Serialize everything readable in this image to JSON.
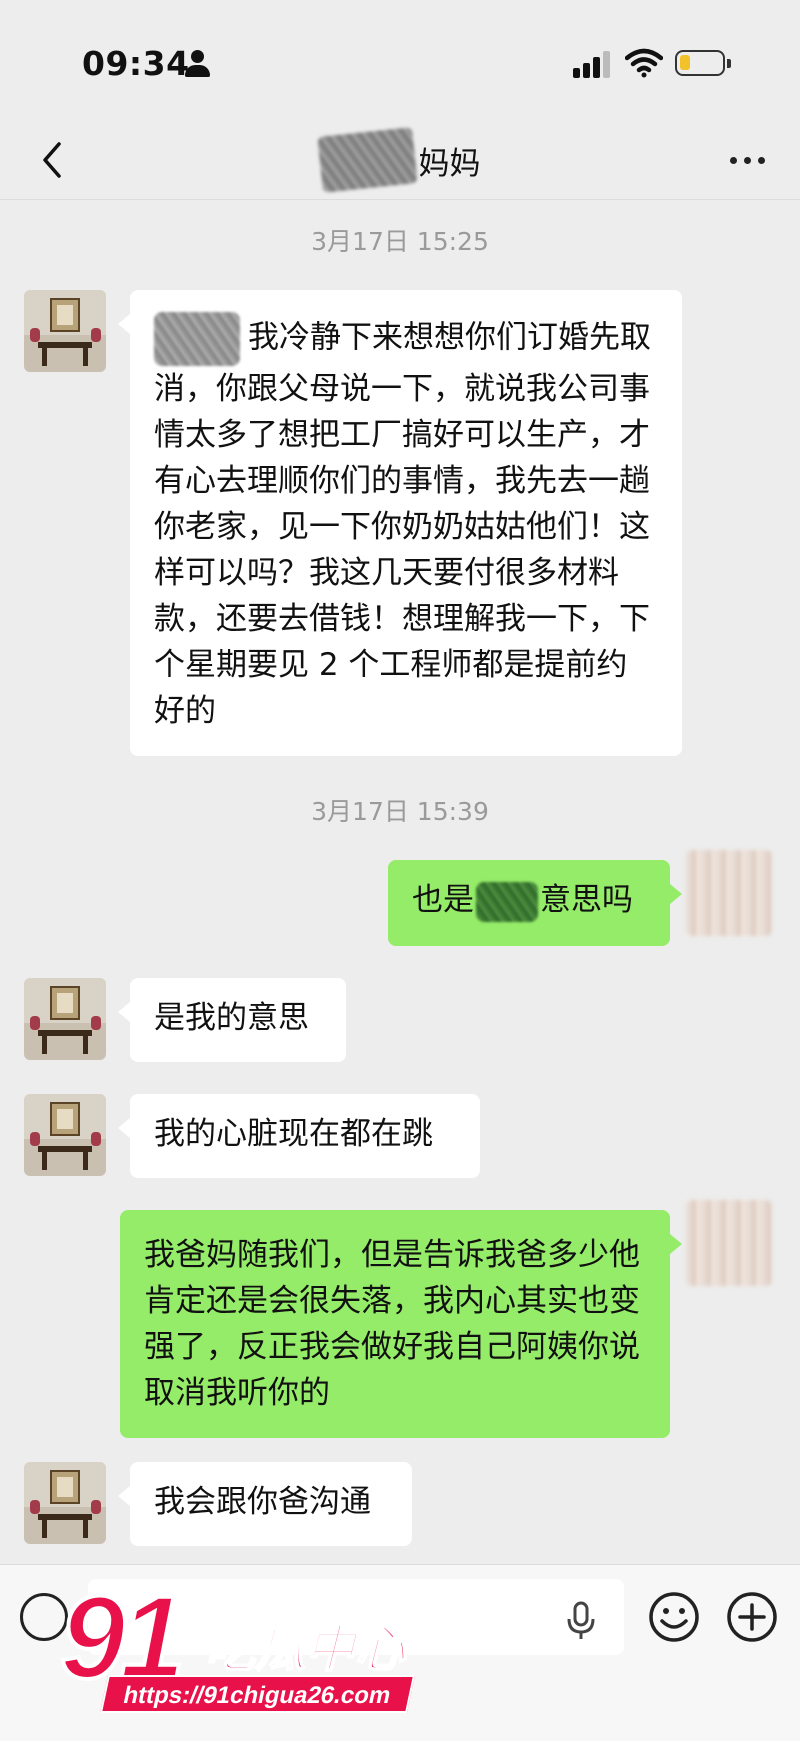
{
  "status_bar": {
    "time": "09:34"
  },
  "header": {
    "title": "妈妈"
  },
  "messages": [
    {
      "type": "time",
      "text": "3月17日 15:25"
    },
    {
      "type": "in",
      "text": "我冷静下来想想你们订婚先取消，你跟父母说一下，就说我公司事情太多了想把工厂搞好可以生产，才有心去理顺你们的事情，我先去一趟你老家，见一下你奶奶姑姑他们！这样可以吗？我这几天要付很多材料款，还要去借钱！想理解我一下，下个星期要见 2 个工程师都是提前约好的"
    },
    {
      "type": "time",
      "text": "3月17日 15:39"
    },
    {
      "type": "out",
      "text_before": "也是",
      "text_after": "意思吗"
    },
    {
      "type": "in",
      "text": "是我的意思"
    },
    {
      "type": "in",
      "text": "我的心脏现在都在跳"
    },
    {
      "type": "out",
      "text": "我爸妈随我们，但是告诉我爸多少他肯定还是会很失落，我内心其实也变强了，反正我会做好我自己阿姨你说取消我听你的"
    },
    {
      "type": "in",
      "text": "我会跟你爸沟通"
    }
  ],
  "input_bar": {
    "message_value": ""
  },
  "watermark": {
    "number": "91",
    "name": "吃瓜中心",
    "url": "https://91chigua26.com"
  },
  "colors": {
    "background": "#ededed",
    "incoming_bubble": "#ffffff",
    "outgoing_bubble": "#95ec69",
    "watermark": "#e8114a"
  }
}
